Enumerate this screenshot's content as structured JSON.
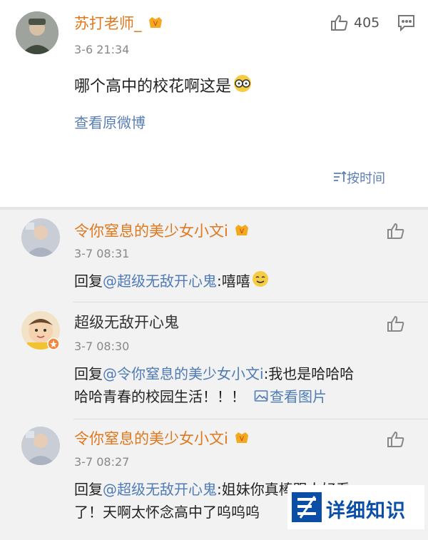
{
  "main_comment": {
    "username": "苏打老师_",
    "time": "3-6 21:34",
    "text": "哪个高中的校花啊这是",
    "emoji": "glasses-emoji",
    "view_original": "查看原微博",
    "like_count": "405",
    "sort_label": "按时间"
  },
  "replies": [
    {
      "username": "令你窒息的美少女小文i",
      "time": "3-7 08:31",
      "reply_prefix": "回复",
      "mention": "@超级无敌开心鬼",
      "text": ":嘻嘻",
      "emoji": "smile-emoji"
    },
    {
      "username": "超级无敌开心鬼",
      "time": "3-7 08:30",
      "reply_prefix": "回复",
      "mention": "@令你窒息的美少女小文i",
      "text_line1": ":我也是哈哈哈",
      "text_line2": "哈哈青春的校园生活！！！",
      "view_image": "查看图片"
    },
    {
      "username": "令你窒息的美少女小文i",
      "time": "3-7 08:27",
      "reply_prefix": "回复",
      "mention": "@超级无敌开心鬼",
      "text_line1": ":姐妹你真棒跟人好看",
      "text_line2": "了！天啊太怀念高中了呜呜呜"
    }
  ],
  "watermark": {
    "text": "详细知识"
  },
  "colors": {
    "username": "#e0781e",
    "mention": "#4f7bb7",
    "link": "#5a7fb5",
    "watermark": "#0a4ea5"
  }
}
